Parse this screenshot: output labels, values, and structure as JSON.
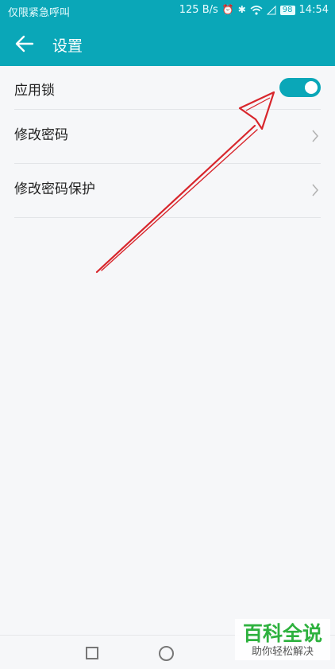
{
  "status_bar": {
    "carrier": "仅限紧急呼叫",
    "speed": "125 B/s",
    "battery": "98",
    "time": "14:54",
    "icons": [
      "alarm-icon",
      "bluetooth-icon",
      "wifi-icon",
      "signal-icon",
      "battery-icon"
    ]
  },
  "app_bar": {
    "title": "设置",
    "back_icon": "arrow-left-icon",
    "background": "#0aa7b8"
  },
  "settings": {
    "items": [
      {
        "label": "应用锁",
        "control": "toggle",
        "toggle_on": true
      },
      {
        "label": "修改密码",
        "control": "chevron"
      },
      {
        "label": "修改密码保护",
        "control": "chevron"
      }
    ]
  },
  "annotation": {
    "color": "#d8262c"
  },
  "nav_bar": {
    "icons": [
      "recent-apps-icon",
      "home-icon"
    ]
  },
  "watermark": {
    "main": "百科全说",
    "sub": "助你轻松解决"
  }
}
